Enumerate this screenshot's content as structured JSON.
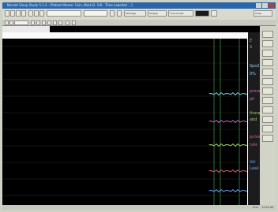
{
  "window": {
    "title": "Nicolet Sleep Study 5.1.4 - [Patient Name: Cain, Mark B. 1/9 - Time Labelled ...]"
  },
  "toolbar": {
    "items": [
      {
        "label": "Montage"
      },
      {
        "label": "Display"
      },
      {
        "label": "Time Graph"
      },
      {
        "label": "Events"
      }
    ],
    "right_button": "Close"
  },
  "statusbar": {
    "left": "",
    "right1": "8/12",
    "right2": "10:15 AM"
  },
  "channels": [
    {
      "label": "E",
      "color": "#7fbf4a"
    },
    {
      "label": "S",
      "color": "#7fbf4a"
    },
    {
      "label": "Spo2",
      "color": "#8ad0e6"
    },
    {
      "label": "0%",
      "color": "#8ad0e6"
    },
    {
      "label": "press",
      "color": "#c667c6"
    },
    {
      "label": "ph",
      "color": "#c667c6"
    },
    {
      "label": "thoracic",
      "color": "#9ad06a"
    },
    {
      "label": "abd",
      "color": "#9ad06a"
    },
    {
      "label": "pulse",
      "color": "#d35b7a"
    },
    {
      "label": "rate",
      "color": "#d35b7a"
    },
    {
      "label": "Vol",
      "color": "#6fa0ff"
    },
    {
      "label": "Leak",
      "color": "#6fa0ff"
    }
  ],
  "colors": {
    "grid": "#3a8a4a",
    "background": "#000000",
    "title_bar": "#2c66a8"
  }
}
